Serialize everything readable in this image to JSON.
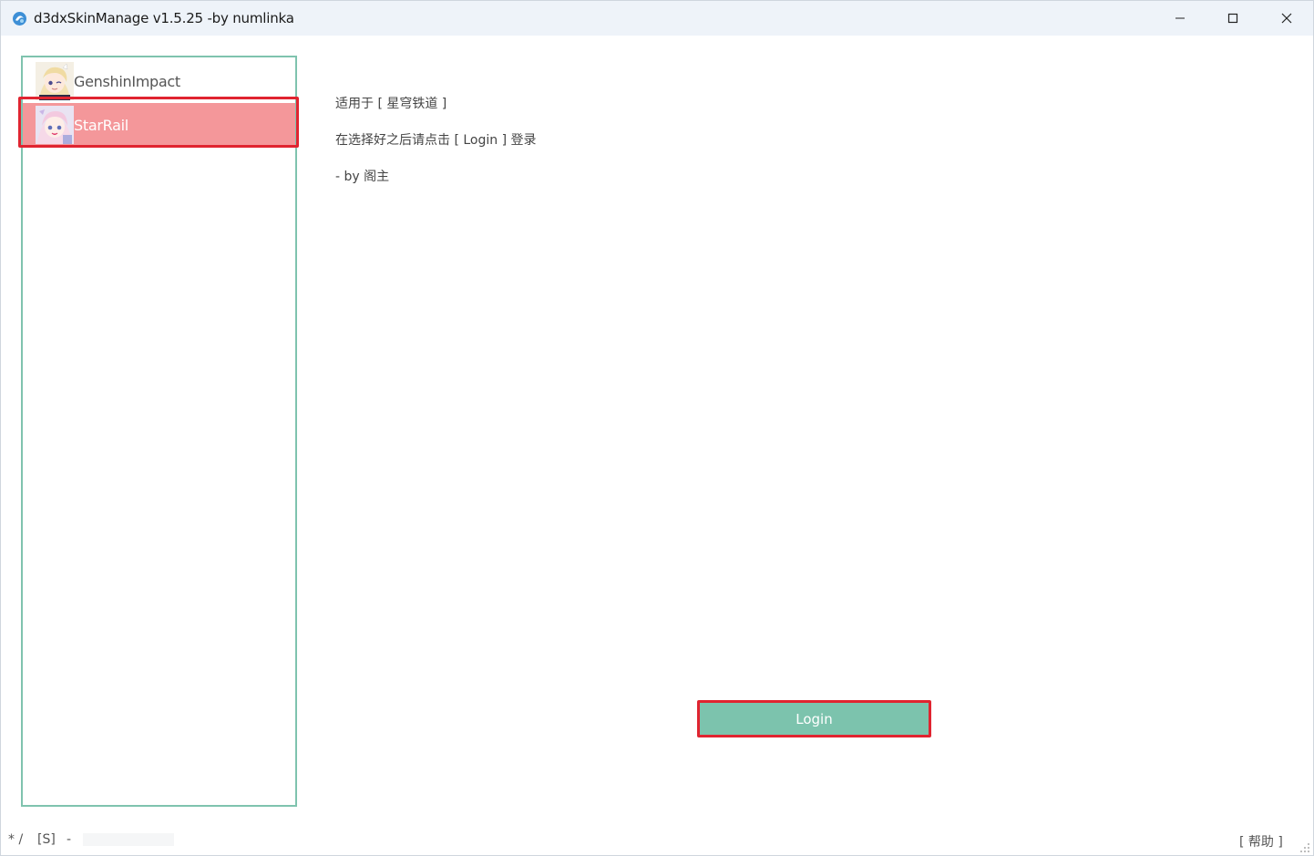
{
  "window": {
    "title": "d3dxSkinManage v1.5.25 -by numlinka"
  },
  "games": [
    {
      "label": "GenshinImpact",
      "avatar_icon": "genshin-character-avatar",
      "selected": false
    },
    {
      "label": "StarRail",
      "avatar_icon": "starrail-character-avatar",
      "selected": true
    }
  ],
  "info": {
    "line1": "适用于 [ 星穹铁道 ]",
    "line2": "在选择好之后请点击 [ Login ] 登录",
    "line3": "- by 阁主"
  },
  "login_label": "Login",
  "status": {
    "s1": "* /",
    "s2": "[S]",
    "s3": "-"
  },
  "help_label": "[ 帮助 ]",
  "colors": {
    "accent": "#7cc3ad",
    "selected_row": "#f4979a",
    "highlight": "#e02430"
  }
}
